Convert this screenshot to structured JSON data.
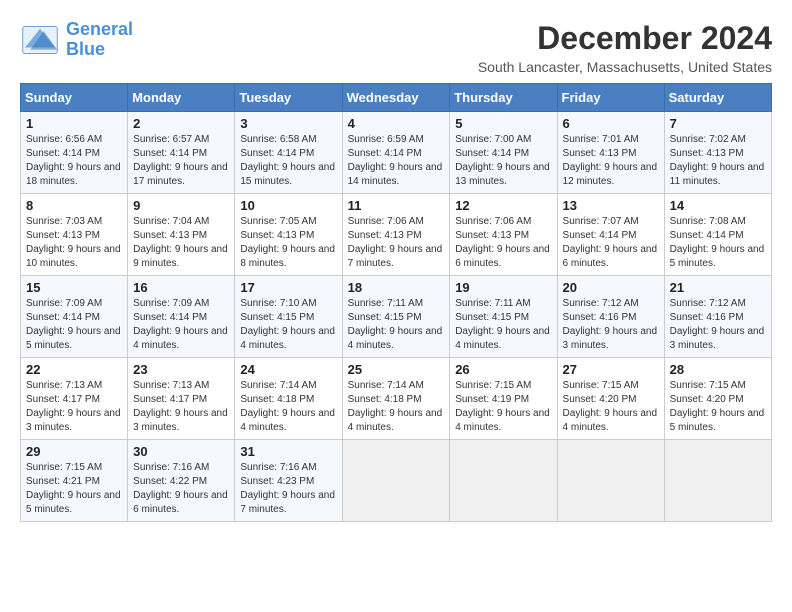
{
  "logo": {
    "line1": "General",
    "line2": "Blue"
  },
  "title": "December 2024",
  "subtitle": "South Lancaster, Massachusetts, United States",
  "days_of_week": [
    "Sunday",
    "Monday",
    "Tuesday",
    "Wednesday",
    "Thursday",
    "Friday",
    "Saturday"
  ],
  "weeks": [
    [
      {
        "day": "1",
        "sunrise": "6:56 AM",
        "sunset": "4:14 PM",
        "daylight": "9 hours and 18 minutes."
      },
      {
        "day": "2",
        "sunrise": "6:57 AM",
        "sunset": "4:14 PM",
        "daylight": "9 hours and 17 minutes."
      },
      {
        "day": "3",
        "sunrise": "6:58 AM",
        "sunset": "4:14 PM",
        "daylight": "9 hours and 15 minutes."
      },
      {
        "day": "4",
        "sunrise": "6:59 AM",
        "sunset": "4:14 PM",
        "daylight": "9 hours and 14 minutes."
      },
      {
        "day": "5",
        "sunrise": "7:00 AM",
        "sunset": "4:14 PM",
        "daylight": "9 hours and 13 minutes."
      },
      {
        "day": "6",
        "sunrise": "7:01 AM",
        "sunset": "4:13 PM",
        "daylight": "9 hours and 12 minutes."
      },
      {
        "day": "7",
        "sunrise": "7:02 AM",
        "sunset": "4:13 PM",
        "daylight": "9 hours and 11 minutes."
      }
    ],
    [
      {
        "day": "8",
        "sunrise": "7:03 AM",
        "sunset": "4:13 PM",
        "daylight": "9 hours and 10 minutes."
      },
      {
        "day": "9",
        "sunrise": "7:04 AM",
        "sunset": "4:13 PM",
        "daylight": "9 hours and 9 minutes."
      },
      {
        "day": "10",
        "sunrise": "7:05 AM",
        "sunset": "4:13 PM",
        "daylight": "9 hours and 8 minutes."
      },
      {
        "day": "11",
        "sunrise": "7:06 AM",
        "sunset": "4:13 PM",
        "daylight": "9 hours and 7 minutes."
      },
      {
        "day": "12",
        "sunrise": "7:06 AM",
        "sunset": "4:13 PM",
        "daylight": "9 hours and 6 minutes."
      },
      {
        "day": "13",
        "sunrise": "7:07 AM",
        "sunset": "4:14 PM",
        "daylight": "9 hours and 6 minutes."
      },
      {
        "day": "14",
        "sunrise": "7:08 AM",
        "sunset": "4:14 PM",
        "daylight": "9 hours and 5 minutes."
      }
    ],
    [
      {
        "day": "15",
        "sunrise": "7:09 AM",
        "sunset": "4:14 PM",
        "daylight": "9 hours and 5 minutes."
      },
      {
        "day": "16",
        "sunrise": "7:09 AM",
        "sunset": "4:14 PM",
        "daylight": "9 hours and 4 minutes."
      },
      {
        "day": "17",
        "sunrise": "7:10 AM",
        "sunset": "4:15 PM",
        "daylight": "9 hours and 4 minutes."
      },
      {
        "day": "18",
        "sunrise": "7:11 AM",
        "sunset": "4:15 PM",
        "daylight": "9 hours and 4 minutes."
      },
      {
        "day": "19",
        "sunrise": "7:11 AM",
        "sunset": "4:15 PM",
        "daylight": "9 hours and 4 minutes."
      },
      {
        "day": "20",
        "sunrise": "7:12 AM",
        "sunset": "4:16 PM",
        "daylight": "9 hours and 3 minutes."
      },
      {
        "day": "21",
        "sunrise": "7:12 AM",
        "sunset": "4:16 PM",
        "daylight": "9 hours and 3 minutes."
      }
    ],
    [
      {
        "day": "22",
        "sunrise": "7:13 AM",
        "sunset": "4:17 PM",
        "daylight": "9 hours and 3 minutes."
      },
      {
        "day": "23",
        "sunrise": "7:13 AM",
        "sunset": "4:17 PM",
        "daylight": "9 hours and 3 minutes."
      },
      {
        "day": "24",
        "sunrise": "7:14 AM",
        "sunset": "4:18 PM",
        "daylight": "9 hours and 4 minutes."
      },
      {
        "day": "25",
        "sunrise": "7:14 AM",
        "sunset": "4:18 PM",
        "daylight": "9 hours and 4 minutes."
      },
      {
        "day": "26",
        "sunrise": "7:15 AM",
        "sunset": "4:19 PM",
        "daylight": "9 hours and 4 minutes."
      },
      {
        "day": "27",
        "sunrise": "7:15 AM",
        "sunset": "4:20 PM",
        "daylight": "9 hours and 4 minutes."
      },
      {
        "day": "28",
        "sunrise": "7:15 AM",
        "sunset": "4:20 PM",
        "daylight": "9 hours and 5 minutes."
      }
    ],
    [
      {
        "day": "29",
        "sunrise": "7:15 AM",
        "sunset": "4:21 PM",
        "daylight": "9 hours and 5 minutes."
      },
      {
        "day": "30",
        "sunrise": "7:16 AM",
        "sunset": "4:22 PM",
        "daylight": "9 hours and 6 minutes."
      },
      {
        "day": "31",
        "sunrise": "7:16 AM",
        "sunset": "4:23 PM",
        "daylight": "9 hours and 7 minutes."
      },
      null,
      null,
      null,
      null
    ]
  ],
  "labels": {
    "sunrise": "Sunrise:",
    "sunset": "Sunset:",
    "daylight": "Daylight:"
  }
}
